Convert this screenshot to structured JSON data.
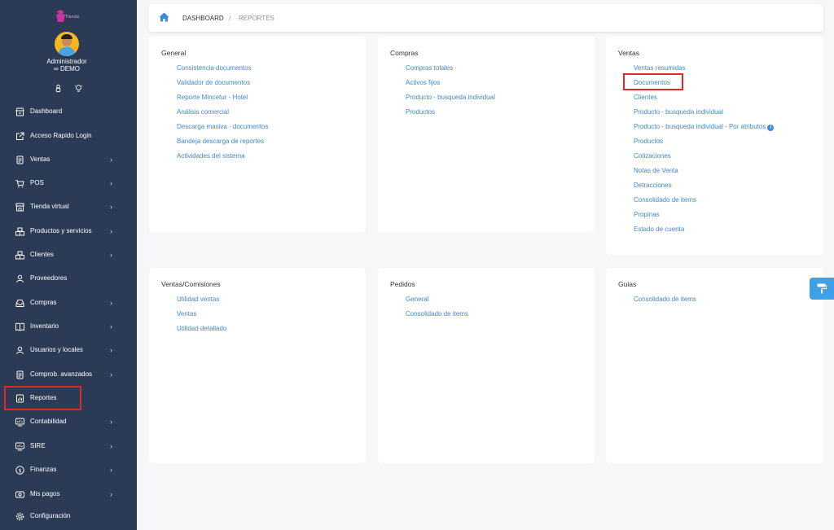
{
  "sidebar": {
    "user_name": "Administrador",
    "user_role": "∞ DEMO",
    "items": [
      {
        "label": "Dashboard",
        "icon": "store-icon",
        "has_submenu": false
      },
      {
        "label": "Acceso Rapido Login",
        "icon": "external-link-icon",
        "has_submenu": false
      },
      {
        "label": "Ventas",
        "icon": "document-icon",
        "has_submenu": true
      },
      {
        "label": "POS",
        "icon": "cart-icon",
        "has_submenu": true
      },
      {
        "label": "Tienda virtual",
        "icon": "shop-icon",
        "has_submenu": true
      },
      {
        "label": "Productos y servicios",
        "icon": "boxes-icon",
        "has_submenu": true
      },
      {
        "label": "Clientes",
        "icon": "users-icon",
        "has_submenu": true
      },
      {
        "label": "Proveedores",
        "icon": "user-icon",
        "has_submenu": false
      },
      {
        "label": "Compras",
        "icon": "inbox-icon",
        "has_submenu": true
      },
      {
        "label": "Inventario",
        "icon": "book-icon",
        "has_submenu": true
      },
      {
        "label": "Usuarios y locales",
        "icon": "user-icon",
        "has_submenu": true
      },
      {
        "label": "Comprob. avanzados",
        "icon": "document-icon",
        "has_submenu": true
      },
      {
        "label": "Reportes",
        "icon": "report-icon",
        "has_submenu": false
      },
      {
        "label": "Contabilidad",
        "icon": "chart-icon",
        "has_submenu": true
      },
      {
        "label": "SIRE",
        "icon": "chart-icon",
        "has_submenu": true
      },
      {
        "label": "Finanzas",
        "icon": "dollar-icon",
        "has_submenu": true
      },
      {
        "label": "Mis pagos",
        "icon": "money-icon",
        "has_submenu": true
      },
      {
        "label": "Configuración",
        "icon": "gear-icon",
        "has_submenu": false
      }
    ]
  },
  "breadcrumb": {
    "home": "DASHBOARD",
    "separator": "/",
    "current": "REPORTES"
  },
  "cards": {
    "general": {
      "title": "General",
      "links": [
        "Consistencia documentos",
        "Validador de documentos",
        "Reporte Mincetur - Hotel",
        "Análisis comercial",
        "Descarga masiva - documentos",
        "Bandeja descarga de reportes",
        "Actividades del sistema"
      ]
    },
    "compras": {
      "title": "Compras",
      "links": [
        "Compras totales",
        "Activos fijos",
        "Producto - busqueda individual",
        "Productos"
      ]
    },
    "ventas": {
      "title": "Ventas",
      "links": [
        "Ventas resumidas",
        "Documentos",
        "Clientes",
        "Producto - busqueda individual",
        "Producto - busqueda individual - Por atributos",
        "Productos",
        "Cotizaciones",
        "Notas de Venta",
        "Detracciones",
        "Consolidado de items",
        "Propinas",
        "Estado de cuenta"
      ],
      "info_glyph": "i"
    },
    "ventas_comisiones": {
      "title": "Ventas/Comisiones",
      "links": [
        "Utilidad ventas",
        "Ventas",
        "Utilidad detallado"
      ]
    },
    "pedidos": {
      "title": "Pedidos",
      "links": [
        "General",
        "Consolidado de items"
      ]
    },
    "guias": {
      "title": "Guias",
      "links": [
        "Consolidado de items"
      ]
    }
  },
  "colors": {
    "sidebar_bg": "#2b3a55",
    "link": "#3b8ad9",
    "highlight": "#e3262b",
    "float_button": "#3ea0e6"
  }
}
